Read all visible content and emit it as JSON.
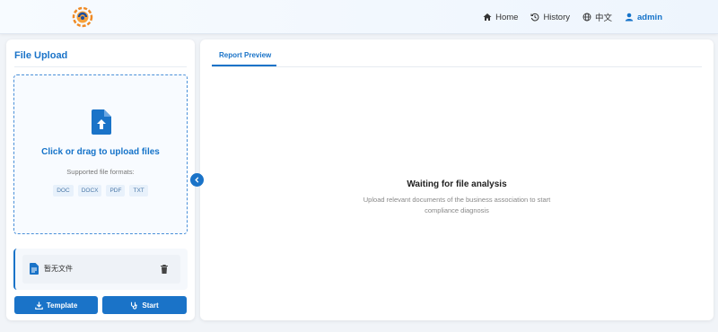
{
  "nav": {
    "home": "Home",
    "history": "History",
    "language": "中文",
    "user": "admin"
  },
  "upload": {
    "title": "File Upload",
    "dropzone_title": "Click or drag to upload files",
    "supported_label": "Supported file formats:",
    "formats": [
      "DOC",
      "DOCX",
      "PDF",
      "TXT"
    ],
    "file_name": "暂无文件",
    "template_button": "Template",
    "start_button": "Start"
  },
  "preview": {
    "tab": "Report Preview",
    "waiting_title": "Waiting for file analysis",
    "waiting_sub": "Upload relevant documents of the business association to start compliance diagnosis"
  },
  "colors": {
    "accent": "#1a73c8",
    "background": "#f1f4f8"
  }
}
